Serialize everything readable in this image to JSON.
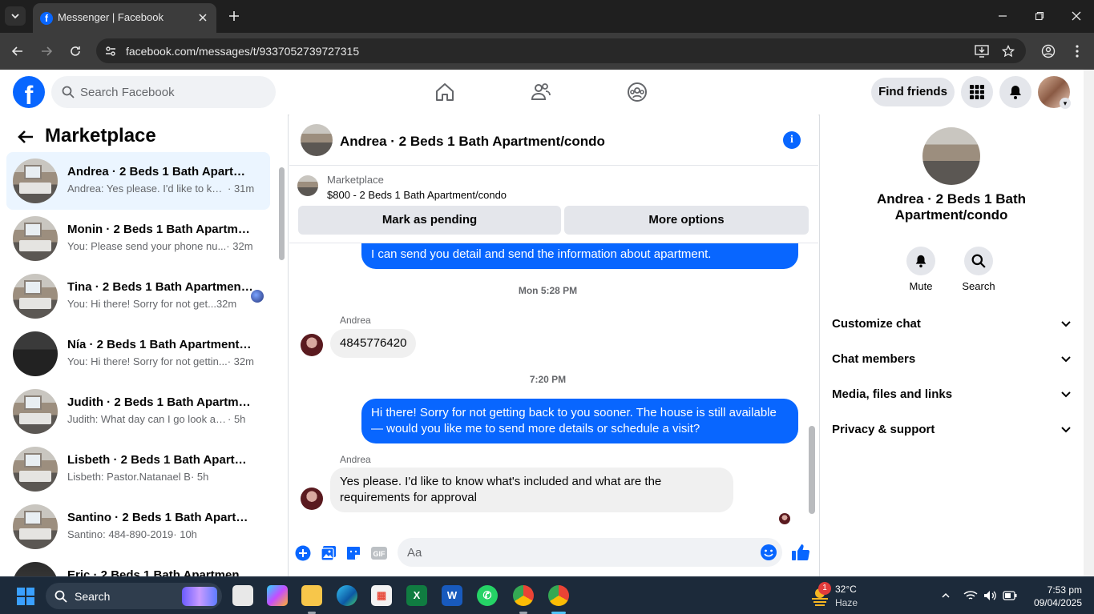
{
  "browser": {
    "tab_title": "Messenger | Facebook",
    "tab_favicon": "facebook-favicon",
    "url": "facebook.com/messages/t/9337052739727315"
  },
  "fb_header": {
    "search_placeholder": "Search Facebook",
    "find_friends": "Find friends"
  },
  "left_panel": {
    "title": "Marketplace",
    "conversations": [
      {
        "title": "Andrea · 2 Beds 1 Bath Apartment/condo",
        "snippet": "Andrea: Yes please. I'd like to kno...",
        "time": " · 31m",
        "active": true
      },
      {
        "title": "Monin · 2 Beds 1 Bath Apartment/condo",
        "snippet": "You: Please send your phone nu...",
        "time": " · 32m"
      },
      {
        "title": "Tina · 2 Beds 1 Bath Apartment/condo",
        "snippet": "You: Hi there! Sorry for not get...",
        "time": " 32m"
      },
      {
        "title": "Nía · 2 Beds 1 Bath Apartment/condo",
        "snippet": "You: Hi there! Sorry for not gettin...",
        "time": " · 32m"
      },
      {
        "title": "Judith · 2 Beds 1 Bath Apartment/condo",
        "snippet": "Judith: What day can I go look at t...",
        "time": " · 5h"
      },
      {
        "title": "Lisbeth · 2 Beds 1 Bath Apartment/condo",
        "snippet": "Lisbeth: Pastor.Natanael B",
        "time": " · 5h"
      },
      {
        "title": "Santino · 2 Beds 1 Bath Apartment/condo",
        "snippet": "Santino: 484-890-2019",
        "time": " · 10h"
      },
      {
        "title": "Eric · 2 Beds 1 Bath Apartment/condo",
        "snippet": "",
        "time": ""
      }
    ]
  },
  "chat": {
    "title": "Andrea · 2 Beds 1 Bath Apartment/condo",
    "marketplace_label": "Marketplace",
    "marketplace_item": "$800 - 2 Beds 1 Bath Apartment/condo",
    "mark_pending": "Mark as pending",
    "more_options": "More options",
    "messages": {
      "out1": "I can send you detail and send the information about apartment.",
      "ts1": "Mon 5:28 PM",
      "sender1": "Andrea",
      "in1": "4845776420",
      "ts2": "7:20 PM",
      "out2": "Hi there! Sorry for not getting back to you sooner. The house is still available — would you like me to send more details or schedule a visit?",
      "sender2": "Andrea",
      "in2": "Yes please. I'd like to know what's included and what are the requirements for approval"
    },
    "composer_placeholder": "Aa"
  },
  "right_panel": {
    "title": "Andrea · 2 Beds 1 Bath Apartment/condo",
    "mute": "Mute",
    "search": "Search",
    "sections": [
      "Customize chat",
      "Chat members",
      "Media, files and links",
      "Privacy & support"
    ]
  },
  "taskbar": {
    "search_label": "Search",
    "weather_temp": "32°C",
    "weather_desc": "Haze",
    "weather_badge": "1",
    "time": "7:53 pm",
    "date": "09/04/2025"
  },
  "colors": {
    "accent": "#0866ff",
    "bubble_in": "#f0f0f0",
    "active_row": "#ebf5ff"
  }
}
